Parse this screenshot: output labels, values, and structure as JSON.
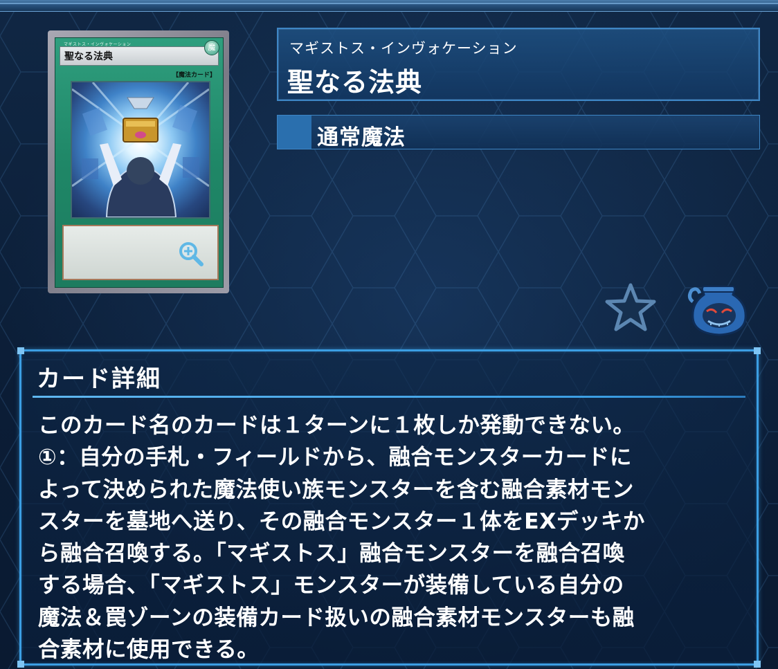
{
  "card": {
    "ruby": "マギストス・インヴォケーション",
    "name": "聖なる法典",
    "type": "通常魔法",
    "image": {
      "name_bar": "聖なる法典",
      "ruby_small": "マギストス・インヴォケーション",
      "attribute_symbol": "魔",
      "type_line": "【魔法カード】",
      "icon": "card-artwork"
    }
  },
  "actions": {
    "zoom_icon": "magnify-plus-icon",
    "favorite_icon": "star-icon",
    "pot_icon": "pot-of-greed-icon"
  },
  "detail": {
    "title": "カード詳細",
    "text": "このカード名のカードは１ターンに１枚しか発動できない。\n①：自分の手札・フィールドから、融合モンスターカードに\nよって決められた魔法使い族モンスターを含む融合素材モン\nスターを墓地へ送り、その融合モンスター１体をEXデッキか\nら融合召喚する。「マギストス」融合モンスターを融合召喚\nする場合、「マギストス」モンスターが装備している自分の\n魔法＆罠ゾーンの装備カード扱いの融合素材モンスターも融\n合素材に使用できる。"
  },
  "colors": {
    "background": "#0c1f3a",
    "accent": "#3b9ee3",
    "spell_card": "#1f8767"
  }
}
